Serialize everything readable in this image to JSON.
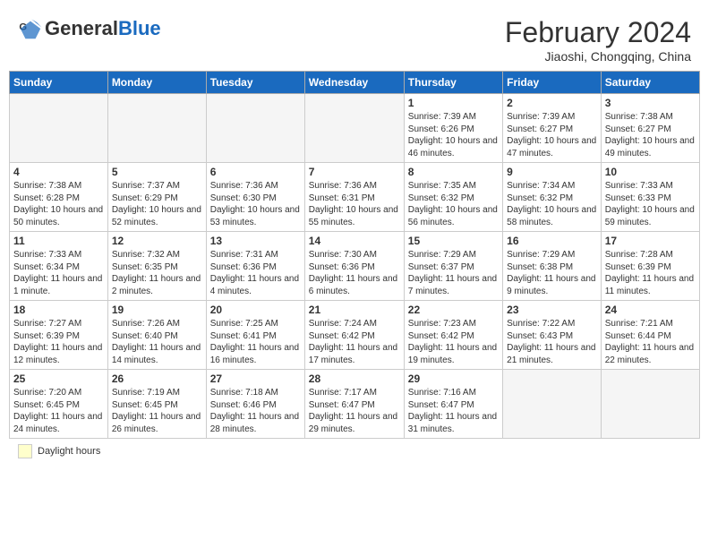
{
  "header": {
    "logo_general": "General",
    "logo_blue": "Blue",
    "month_title": "February 2024",
    "location": "Jiaoshi, Chongqing, China"
  },
  "weekdays": [
    "Sunday",
    "Monday",
    "Tuesday",
    "Wednesday",
    "Thursday",
    "Friday",
    "Saturday"
  ],
  "weeks": [
    [
      {
        "day": "",
        "info": ""
      },
      {
        "day": "",
        "info": ""
      },
      {
        "day": "",
        "info": ""
      },
      {
        "day": "",
        "info": ""
      },
      {
        "day": "1",
        "info": "Sunrise: 7:39 AM\nSunset: 6:26 PM\nDaylight: 10 hours and 46 minutes."
      },
      {
        "day": "2",
        "info": "Sunrise: 7:39 AM\nSunset: 6:27 PM\nDaylight: 10 hours and 47 minutes."
      },
      {
        "day": "3",
        "info": "Sunrise: 7:38 AM\nSunset: 6:27 PM\nDaylight: 10 hours and 49 minutes."
      }
    ],
    [
      {
        "day": "4",
        "info": "Sunrise: 7:38 AM\nSunset: 6:28 PM\nDaylight: 10 hours and 50 minutes."
      },
      {
        "day": "5",
        "info": "Sunrise: 7:37 AM\nSunset: 6:29 PM\nDaylight: 10 hours and 52 minutes."
      },
      {
        "day": "6",
        "info": "Sunrise: 7:36 AM\nSunset: 6:30 PM\nDaylight: 10 hours and 53 minutes."
      },
      {
        "day": "7",
        "info": "Sunrise: 7:36 AM\nSunset: 6:31 PM\nDaylight: 10 hours and 55 minutes."
      },
      {
        "day": "8",
        "info": "Sunrise: 7:35 AM\nSunset: 6:32 PM\nDaylight: 10 hours and 56 minutes."
      },
      {
        "day": "9",
        "info": "Sunrise: 7:34 AM\nSunset: 6:32 PM\nDaylight: 10 hours and 58 minutes."
      },
      {
        "day": "10",
        "info": "Sunrise: 7:33 AM\nSunset: 6:33 PM\nDaylight: 10 hours and 59 minutes."
      }
    ],
    [
      {
        "day": "11",
        "info": "Sunrise: 7:33 AM\nSunset: 6:34 PM\nDaylight: 11 hours and 1 minute."
      },
      {
        "day": "12",
        "info": "Sunrise: 7:32 AM\nSunset: 6:35 PM\nDaylight: 11 hours and 2 minutes."
      },
      {
        "day": "13",
        "info": "Sunrise: 7:31 AM\nSunset: 6:36 PM\nDaylight: 11 hours and 4 minutes."
      },
      {
        "day": "14",
        "info": "Sunrise: 7:30 AM\nSunset: 6:36 PM\nDaylight: 11 hours and 6 minutes."
      },
      {
        "day": "15",
        "info": "Sunrise: 7:29 AM\nSunset: 6:37 PM\nDaylight: 11 hours and 7 minutes."
      },
      {
        "day": "16",
        "info": "Sunrise: 7:29 AM\nSunset: 6:38 PM\nDaylight: 11 hours and 9 minutes."
      },
      {
        "day": "17",
        "info": "Sunrise: 7:28 AM\nSunset: 6:39 PM\nDaylight: 11 hours and 11 minutes."
      }
    ],
    [
      {
        "day": "18",
        "info": "Sunrise: 7:27 AM\nSunset: 6:39 PM\nDaylight: 11 hours and 12 minutes."
      },
      {
        "day": "19",
        "info": "Sunrise: 7:26 AM\nSunset: 6:40 PM\nDaylight: 11 hours and 14 minutes."
      },
      {
        "day": "20",
        "info": "Sunrise: 7:25 AM\nSunset: 6:41 PM\nDaylight: 11 hours and 16 minutes."
      },
      {
        "day": "21",
        "info": "Sunrise: 7:24 AM\nSunset: 6:42 PM\nDaylight: 11 hours and 17 minutes."
      },
      {
        "day": "22",
        "info": "Sunrise: 7:23 AM\nSunset: 6:42 PM\nDaylight: 11 hours and 19 minutes."
      },
      {
        "day": "23",
        "info": "Sunrise: 7:22 AM\nSunset: 6:43 PM\nDaylight: 11 hours and 21 minutes."
      },
      {
        "day": "24",
        "info": "Sunrise: 7:21 AM\nSunset: 6:44 PM\nDaylight: 11 hours and 22 minutes."
      }
    ],
    [
      {
        "day": "25",
        "info": "Sunrise: 7:20 AM\nSunset: 6:45 PM\nDaylight: 11 hours and 24 minutes."
      },
      {
        "day": "26",
        "info": "Sunrise: 7:19 AM\nSunset: 6:45 PM\nDaylight: 11 hours and 26 minutes."
      },
      {
        "day": "27",
        "info": "Sunrise: 7:18 AM\nSunset: 6:46 PM\nDaylight: 11 hours and 28 minutes."
      },
      {
        "day": "28",
        "info": "Sunrise: 7:17 AM\nSunset: 6:47 PM\nDaylight: 11 hours and 29 minutes."
      },
      {
        "day": "29",
        "info": "Sunrise: 7:16 AM\nSunset: 6:47 PM\nDaylight: 11 hours and 31 minutes."
      },
      {
        "day": "",
        "info": ""
      },
      {
        "day": "",
        "info": ""
      }
    ]
  ],
  "legend": {
    "box_color": "#ffffcc",
    "label": "Daylight hours"
  }
}
